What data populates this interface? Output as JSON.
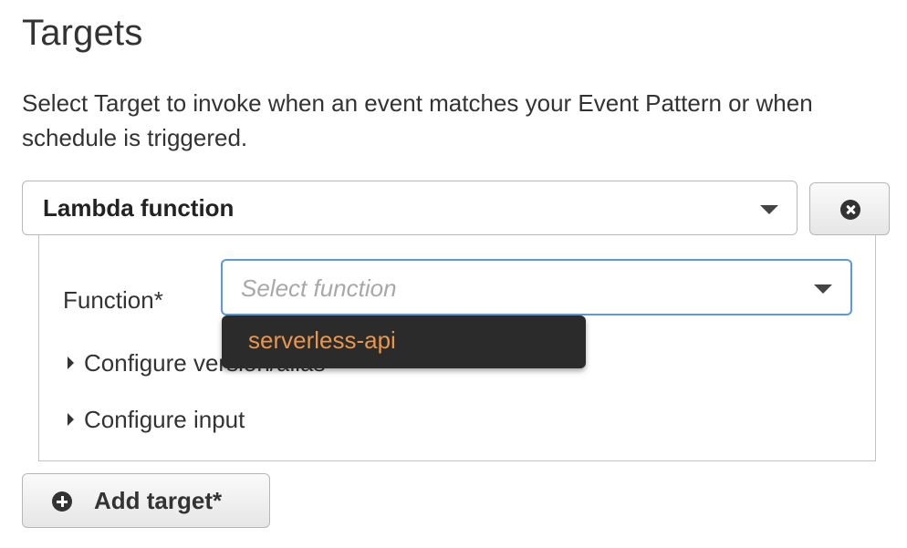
{
  "section": {
    "title": "Targets",
    "description": "Select Target to invoke when an event matches your Event Pattern or when schedule is triggered."
  },
  "target": {
    "type_value": "Lambda function",
    "remove_icon": "remove-circle-icon",
    "function_label": "Function*",
    "function_placeholder": "Select function",
    "dropdown_options": [
      "serverless-api"
    ],
    "configure_version_label": "Configure version/alias",
    "configure_input_label": "Configure input"
  },
  "actions": {
    "add_target_label": "Add target*",
    "add_icon": "plus-circle-icon"
  },
  "colors": {
    "focus_border": "#5b9ad8",
    "dropdown_bg": "#2b2b2b",
    "dropdown_text": "#e8964b"
  }
}
